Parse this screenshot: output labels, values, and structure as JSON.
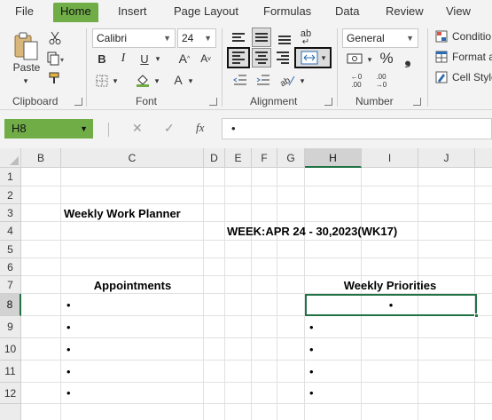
{
  "menu": {
    "tabs": [
      "File",
      "Home",
      "Insert",
      "Page Layout",
      "Formulas",
      "Data",
      "Review",
      "View"
    ],
    "active": "Home"
  },
  "ribbon": {
    "clipboard": {
      "paste_label": "Paste",
      "group_label": "Clipboard"
    },
    "font": {
      "font_name": "Calibri",
      "font_size": "24",
      "bold": "B",
      "italic": "I",
      "underline": "U",
      "grow": "A",
      "shrink": "A",
      "font_color": "A",
      "group_label": "Font"
    },
    "alignment": {
      "wrap_text": "ab",
      "group_label": "Alignment"
    },
    "number": {
      "format": "General",
      "percent": "%",
      "comma": "❟",
      "inc_decimal": ".00",
      "dec_decimal": ".00",
      "group_label": "Number"
    },
    "styles": {
      "conditional": "Conditio",
      "format_as": "Format a",
      "cell_style": "Cell Style"
    }
  },
  "formula_bar": {
    "name_box": "H8",
    "cancel": "✕",
    "enter": "✓",
    "fx": "fx",
    "content": "•"
  },
  "grid": {
    "columns": [
      "B",
      "C",
      "D",
      "E",
      "F",
      "G",
      "H",
      "I",
      "J"
    ],
    "selected_column": "H",
    "rows": [
      "1",
      "2",
      "3",
      "4",
      "5",
      "6",
      "7",
      "8",
      "9",
      "10",
      "11",
      "12"
    ],
    "selected_row": "8",
    "cells": {
      "C3": "Weekly Work Planner",
      "E4": "WEEK:APR 24 - 30,2023(WK17)",
      "C7": "Appointments",
      "H7": "Weekly Priorities",
      "C8": "•",
      "H8": "•",
      "C9": "•",
      "H9": "•",
      "C10": "•",
      "H10": "•",
      "C11": "•",
      "H11": "•",
      "C12": "•",
      "H12": "•"
    }
  },
  "colors": {
    "accent": "#70ad47",
    "selection": "#217346",
    "ribbon_bg": "#f3f3f3"
  }
}
